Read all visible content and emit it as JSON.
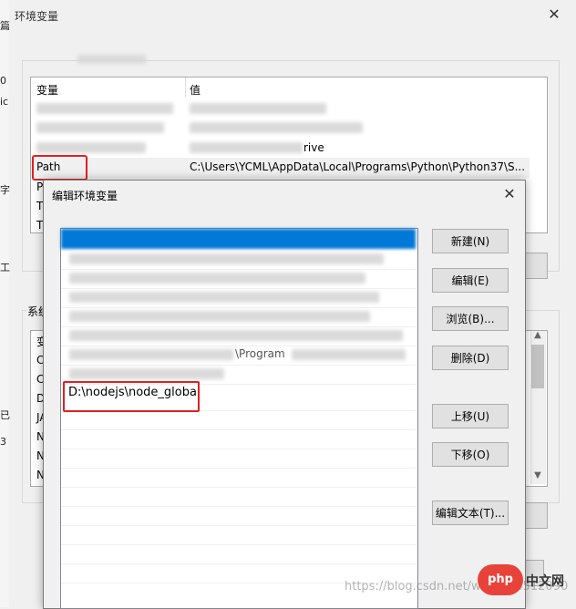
{
  "outer": {
    "title": "环境变量",
    "close": "✕",
    "list": {
      "col_var": "变量",
      "col_val": "值",
      "partial_text": "rive",
      "path_row": {
        "name": "Path",
        "value": "C:\\Users\\YCML\\AppData\\Local\\Programs\\Python\\Python37\\S..."
      },
      "clipped_rows": [
        "P",
        "T",
        "T"
      ]
    },
    "lower": {
      "label_clip": "系统",
      "rows_clip": [
        "变",
        "C",
        "C",
        "D",
        "JA",
        "N",
        "N",
        "N"
      ]
    },
    "left_edge_chars": [
      "篇",
      "0",
      "ic",
      "字",
      "工",
      "已",
      "3"
    ]
  },
  "dialog": {
    "title": "编辑环境变量",
    "close": "✕",
    "entries": {
      "partial_text": "\\Program",
      "new_entry": "D:\\nodejs\\node_global"
    },
    "buttons": {
      "new": "新建(N)",
      "edit": "编辑(E)",
      "browse": "浏览(B)...",
      "delete": "删除(D)",
      "up": "上移(U)",
      "down": "下移(O)",
      "edit_text": "编辑文本(T)..."
    }
  },
  "watermark": {
    "url": "https://blog.csdn.net/weixin_4512090",
    "logo": "php",
    "cn": "中文网"
  },
  "colors": {
    "selection": "#0078d7",
    "highlight_box": "#e02020"
  }
}
